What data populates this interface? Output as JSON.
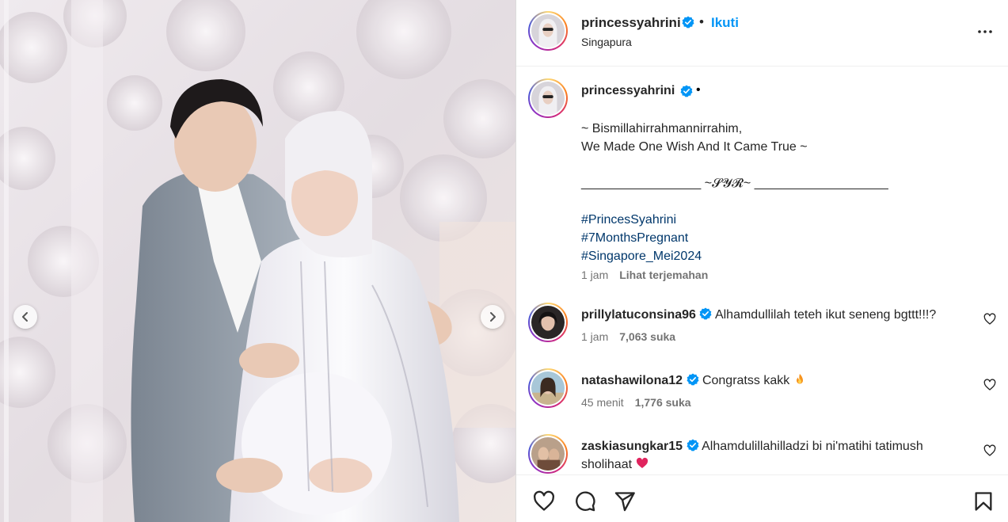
{
  "colors": {
    "link_blue": "#0095f6",
    "hashtag": "#00376b",
    "secondary_text": "#737373",
    "verified_badge": "#0095f6",
    "heart_emoji": "#e0245e",
    "fire_emoji": "#f7931e"
  },
  "header": {
    "username": "princessyahrini",
    "separator": "•",
    "follow_label": "Ikuti",
    "location": "Singapura",
    "more_icon": "more-horizontal-icon"
  },
  "caption": {
    "username": "princessyahrini",
    "separator": "•",
    "lines": [
      "~ Bismillahirrahmannirrahim,",
      "We Made One Wish And It Came True ~",
      "",
      "_________________ ~𝓢𝓨𝓡~ ___________________",
      ""
    ],
    "hashtags": [
      "#PrincesSyahrini",
      "#7MonthsPregnant",
      "#Singapore_Mei2024"
    ],
    "time": "1 jam",
    "translate_label": "Lihat terjemahan"
  },
  "comments": [
    {
      "username": "prillylatuconsina96",
      "text": "Alhamdullilah teteh ikut seneng bgttt!!!?",
      "time": "1 jam",
      "likes": "7,063 suka",
      "emoji": ""
    },
    {
      "username": "natashawilona12",
      "text": "Congratss kakk",
      "time": "45 menit",
      "likes": "1,776 suka",
      "emoji": "fire-emoji"
    },
    {
      "username": "zaskiasungkar15",
      "text": "Alhamdulillahilladzi bi ni'matihi tatimush sholihaat",
      "time": "",
      "likes": "",
      "emoji": "red-heart-emoji"
    }
  ],
  "media": {
    "prev_icon": "chevron-left-icon",
    "next_icon": "chevron-right-icon"
  },
  "actions": {
    "like_icon": "heart-icon",
    "comment_icon": "comment-icon",
    "share_icon": "send-icon",
    "save_icon": "bookmark-icon"
  }
}
